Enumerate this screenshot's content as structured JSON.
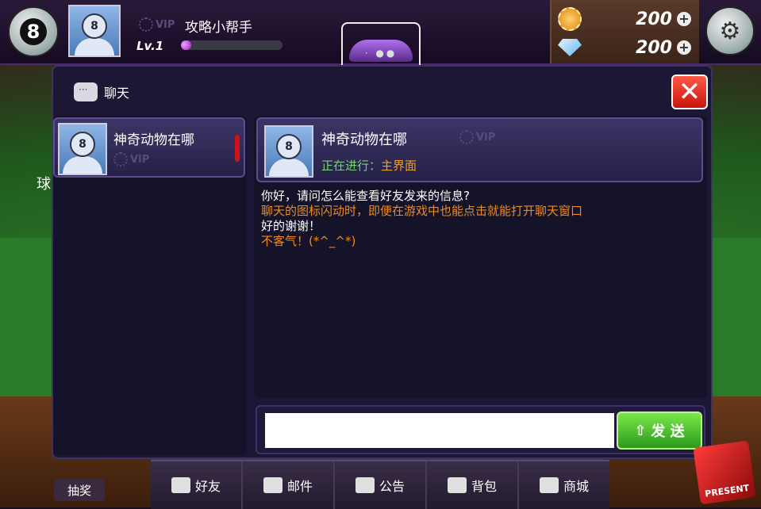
{
  "topbar": {
    "logo_glyph": "8",
    "player_name": "攻略小帮手",
    "vip_label": "VIP",
    "level_label": "Lv.1",
    "xp_progress": 0.05,
    "coins": "200",
    "gems": "200",
    "plus_glyph": "+"
  },
  "chat_panel": {
    "title": "聊天",
    "close_glyph": "✕",
    "friends": [
      {
        "name": "神奇动物在哪",
        "vip": "VIP"
      }
    ],
    "conversation": {
      "name": "神奇动物在哪",
      "vip": "VIP",
      "status_prefix": "正在进行：",
      "status_location": "主界面"
    },
    "messages": [
      {
        "text": "你好，请问怎么能查看好友发来的信息?",
        "color": "white"
      },
      {
        "text": "聊天的图标闪动时，即便在游戏中也能点击就能打开聊天窗口",
        "color": "orange"
      },
      {
        "text": "好的谢谢！",
        "color": "white"
      },
      {
        "text": "不客气！(*^_^*)",
        "color": "orange"
      }
    ],
    "input_value": "",
    "send_label": "发 送",
    "send_icon": "⇧"
  },
  "bottom_nav": [
    {
      "label": "好友",
      "icon": "friends-icon"
    },
    {
      "label": "邮件",
      "icon": "mail-icon"
    },
    {
      "label": "公告",
      "icon": "warning-icon"
    },
    {
      "label": "背包",
      "icon": "bag-icon"
    },
    {
      "label": "商城",
      "icon": "cart-icon"
    }
  ],
  "lottery_label": "抽奖",
  "present_label": "PRESENT",
  "side_fragment": "球",
  "colors": {
    "panel_bg": "#1b1734",
    "accent_orange": "#f08a1a",
    "status_green": "#7ad07a",
    "close_red": "#d8241a",
    "send_green": "#4ac82a"
  }
}
